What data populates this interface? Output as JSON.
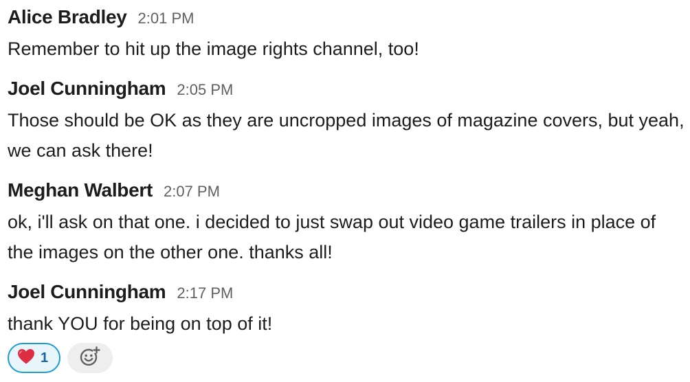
{
  "messages": [
    {
      "author": "Alice Bradley",
      "time": "2:01 PM",
      "text": "Remember to hit up the image rights channel, too!"
    },
    {
      "author": "Joel Cunningham",
      "time": "2:05 PM",
      "text": "Those should be OK as they are uncropped images of magazine covers, but yeah, we can ask there!"
    },
    {
      "author": "Meghan Walbert",
      "time": "2:07 PM",
      "text": "ok, i'll ask on that one. i decided to just swap out video game trailers in place of the images on the other one. thanks all!"
    },
    {
      "author": "Joel Cunningham",
      "time": "2:17 PM",
      "text": "thank YOU for being on top of it!"
    }
  ],
  "reactions": [
    {
      "emoji": "❤️",
      "count": "1",
      "icon": "heart-icon",
      "active_border_color": "#1d9bd1"
    }
  ],
  "add_reaction": {
    "icon": "add-emoji-icon"
  }
}
